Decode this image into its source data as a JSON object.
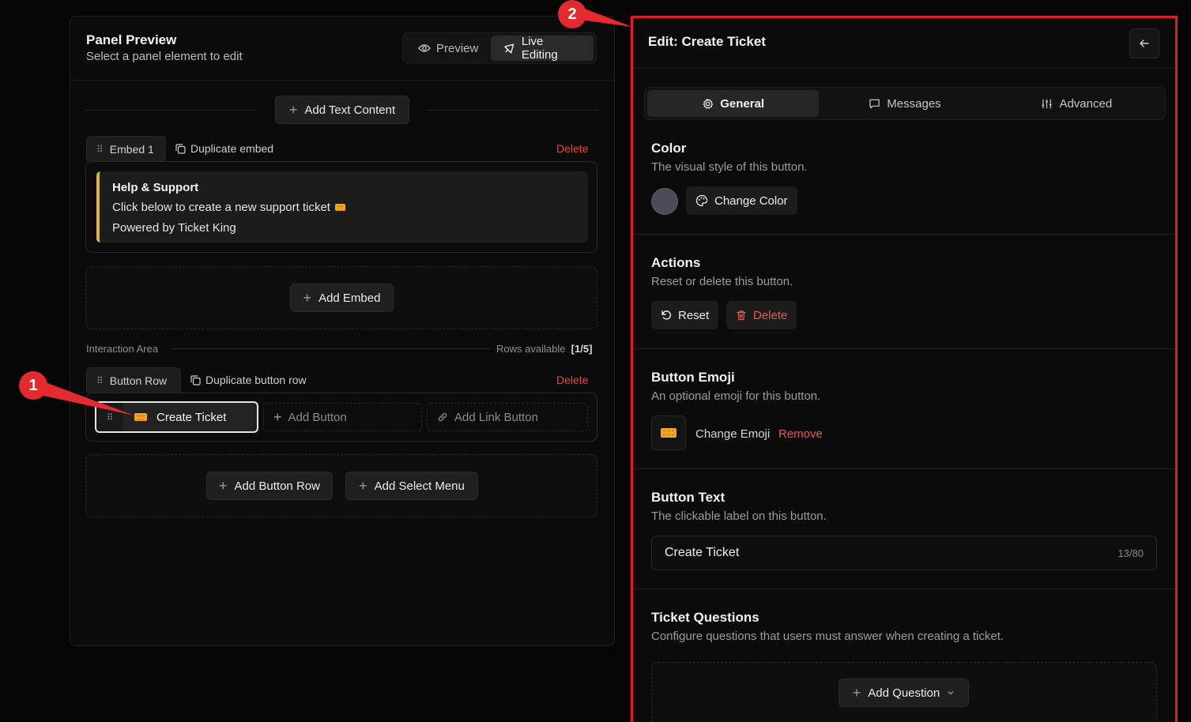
{
  "preview": {
    "title": "Panel Preview",
    "subtitle": "Select a panel element to edit",
    "mode_preview": "Preview",
    "mode_live": "Live Editing",
    "add_text_content": "Add Text Content",
    "embed_tab": "Embed 1",
    "duplicate_embed": "Duplicate embed",
    "delete": "Delete",
    "embed": {
      "title": "Help & Support",
      "line1": "Click below to create a new support ticket",
      "line2": "Powered by Ticket King",
      "accent": "#e2b33c"
    },
    "add_embed": "Add Embed",
    "interaction_area": "Interaction Area",
    "rows_available_label": "Rows available",
    "rows_available_value": "[1/5]",
    "button_row_tab": "Button Row",
    "duplicate_button_row": "Duplicate button row",
    "create_ticket": "Create Ticket",
    "add_button": "Add Button",
    "add_link_button": "Add Link Button",
    "add_button_row": "Add Button Row",
    "add_select_menu": "Add Select Menu"
  },
  "editor": {
    "title": "Edit: Create Ticket",
    "tabs": [
      {
        "label": "General",
        "icon": "gear-icon",
        "active": true
      },
      {
        "label": "Messages",
        "icon": "message-icon",
        "active": false
      },
      {
        "label": "Advanced",
        "icon": "sliders-icon",
        "active": false
      }
    ],
    "color": {
      "title": "Color",
      "desc": "The visual style of this button.",
      "swatch": "#4b4c57",
      "change_color": "Change Color"
    },
    "actions": {
      "title": "Actions",
      "desc": "Reset or delete this button.",
      "reset": "Reset",
      "delete": "Delete"
    },
    "emoji": {
      "title": "Button Emoji",
      "desc": "An optional emoji for this button.",
      "change": "Change Emoji",
      "remove": "Remove"
    },
    "button_text": {
      "title": "Button Text",
      "desc": "The clickable label on this button.",
      "value": "Create Ticket",
      "count": "13/80"
    },
    "questions": {
      "title": "Ticket Questions",
      "desc": "Configure questions that users must answer when creating a ticket.",
      "add_question": "Add Question"
    }
  },
  "annotations": {
    "badge1": "1",
    "badge2": "2",
    "color": "#e32b2f"
  }
}
